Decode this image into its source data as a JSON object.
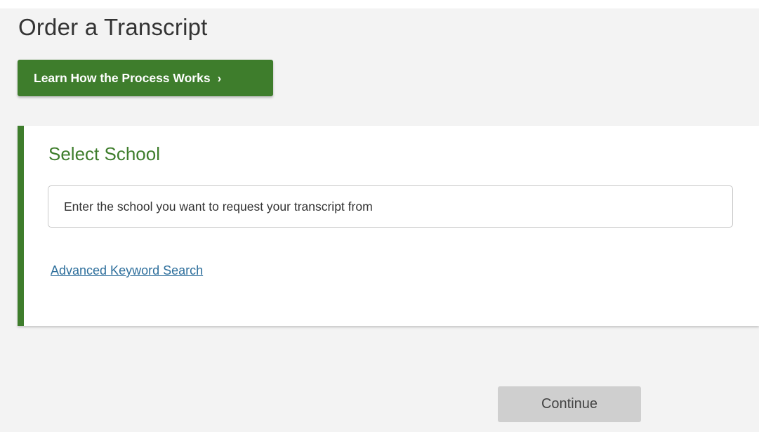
{
  "page": {
    "title": "Order a Transcript",
    "background_color": "#f3f3f3"
  },
  "learn_button": {
    "label": "Learn How the Process Works",
    "chevron": "›",
    "icon": "chevron-right-icon",
    "color": "#3e7d2c"
  },
  "select_school": {
    "title": "Select School",
    "accent_color": "#3e7d2c",
    "search_input": {
      "value": "",
      "placeholder": "Enter the school you want to request your transcript from"
    },
    "advanced_link": "Advanced Keyword Search",
    "link_color": "#2e6f9c"
  },
  "continue_button": {
    "label": "Continue",
    "state": "disabled",
    "color": "#cfcfcf"
  }
}
